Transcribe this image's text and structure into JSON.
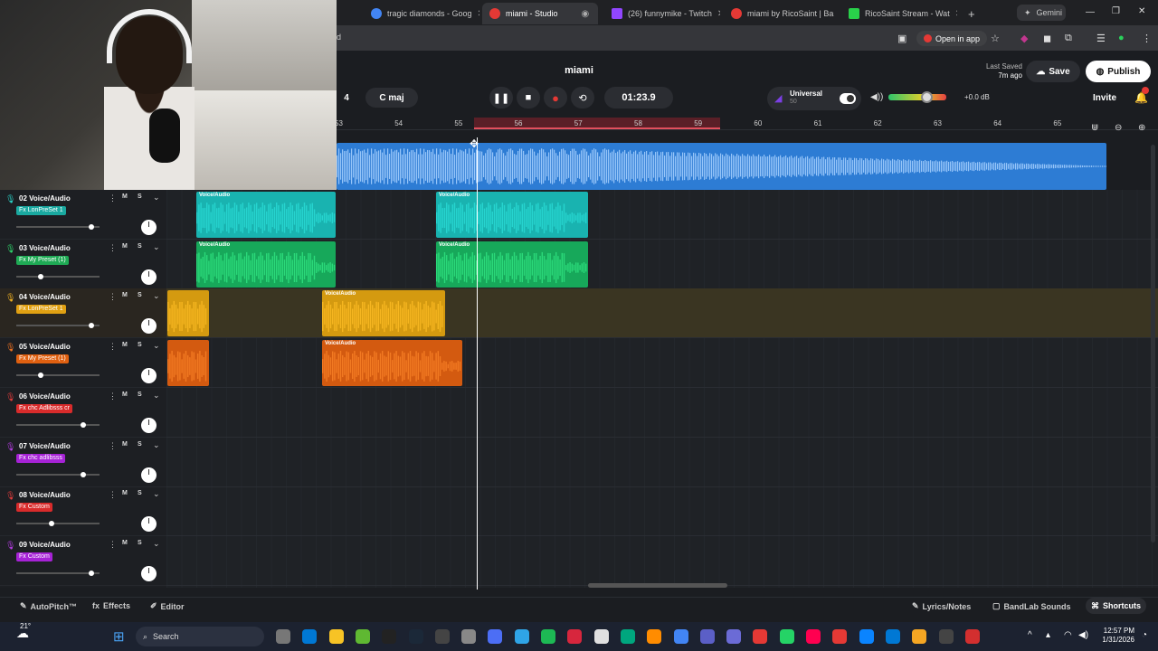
{
  "browser": {
    "tabs": [
      {
        "label": "tragic diamonds - Goog",
        "color": "#4285f4"
      },
      {
        "label": "miami - Studio",
        "color": "#e53935",
        "active": true
      },
      {
        "label": "(26) funnymike - Twitch",
        "color": "#9146ff"
      },
      {
        "label": "miami by RicoSaint | Ba",
        "color": "#e53935"
      },
      {
        "label": "RicoSaint Stream - Wat",
        "color": "#29d14a"
      }
    ],
    "new_tab": "+",
    "gemini": "Gemini",
    "open_in_app": "Open in app",
    "address_fragment": "d"
  },
  "studio": {
    "song_title": "miami",
    "last_saved_label": "Last Saved",
    "last_saved_value": "7m ago",
    "save_label": "Save",
    "publish_label": "Publish",
    "invite_label": "Invite",
    "bpm_fragment": "4",
    "key": "C maj",
    "time": "01:23.9",
    "autopitch_name": "Universal",
    "autopitch_value": "50",
    "volume_db": "+0.0 dB",
    "volume_level": 0.65
  },
  "ruler": {
    "bars": [
      "53",
      "54",
      "55",
      "56",
      "57",
      "58",
      "59",
      "60",
      "61",
      "62",
      "63",
      "64",
      "65"
    ]
  },
  "tracks": [
    {
      "name": "02  Voice/Audio",
      "fx": "Fx LonPreSet 1",
      "fx_color": "#1aa9a0",
      "mic_color": "#2ad1c5",
      "fader": 0.93
    },
    {
      "name": "03  Voice/Audio",
      "fx": "Fx My Preset (1)",
      "fx_color": "#1faa55",
      "mic_color": "#2ed46a",
      "fader": 0.28
    },
    {
      "name": "04  Voice/Audio",
      "fx": "Fx LonPreSet 1",
      "fx_color": "#e0a012",
      "mic_color": "#f0b121",
      "fader": 0.93,
      "selected": true
    },
    {
      "name": "05  Voice/Audio",
      "fx": "Fx My Preset (1)",
      "fx_color": "#e06010",
      "mic_color": "#f07221",
      "fader": 0.28
    },
    {
      "name": "06  Voice/Audio",
      "fx": "Fx chc Adlibsss cr",
      "fx_color": "#d92b2b",
      "mic_color": "#e03b3b",
      "fader": 0.83
    },
    {
      "name": "07  Voice/Audio",
      "fx": "Fx chc adlibsss",
      "fx_color": "#a622d6",
      "mic_color": "#b23be0",
      "fader": 0.83
    },
    {
      "name": "08  Voice/Audio",
      "fx": "Fx Custom",
      "fx_color": "#d92b2b",
      "mic_color": "#e03b3b",
      "fader": 0.42
    },
    {
      "name": "09  Voice/Audio",
      "fx": "Fx Custom",
      "fx_color": "#a622d6",
      "mic_color": "#b23be0",
      "fader": 0.93
    }
  ],
  "track_buttons": {
    "mute": "M",
    "solo": "S"
  },
  "clip_label": "Voice/Audio",
  "bottom": {
    "autopitch": "AutoPitch™",
    "effects": "Effects",
    "editor": "Editor",
    "lyrics": "Lyrics/Notes",
    "sounds": "BandLab Sounds",
    "shortcuts": "Shortcuts"
  },
  "taskbar": {
    "weather": "21°",
    "search": "Search",
    "time": "12:57 PM",
    "date": "1/31/2026"
  }
}
